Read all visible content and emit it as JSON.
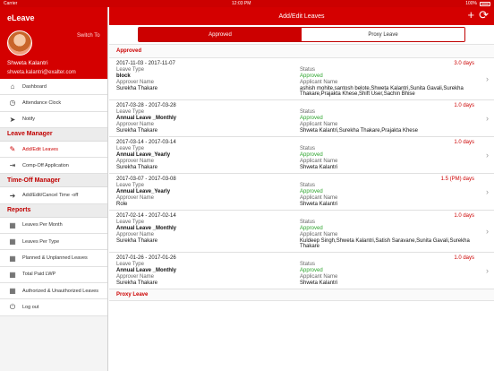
{
  "status_bar": {
    "carrier": "Carrier",
    "time": "12:03 PM",
    "battery": "100%"
  },
  "sidebar": {
    "app_title": "eLeave",
    "switch_to": "Switch To",
    "user_name": "Shweta Kalantri",
    "user_email": "shweta.kalantri@exalter.com",
    "items_top": [
      {
        "label": "Dashboard",
        "icon": "dashboard-icon"
      },
      {
        "label": "Attendance Clock",
        "icon": "clock-icon"
      },
      {
        "label": "Notify",
        "icon": "send-icon"
      }
    ],
    "section_leave": "Leave Manager",
    "items_leave": [
      {
        "label": "Add/Edit Leaves",
        "icon": "edit-icon"
      },
      {
        "label": "Comp-Off Application",
        "icon": "compoff-icon"
      }
    ],
    "section_timeoff": "Time-Off Manager",
    "items_timeoff": [
      {
        "label": "Add/Edit/Cancel Time -off",
        "icon": "arrow-icon"
      }
    ],
    "section_reports": "Reports",
    "items_reports": [
      {
        "label": "Leaves Per Month",
        "icon": "calendar-icon"
      },
      {
        "label": "Leaves Per Type",
        "icon": "calendar-icon"
      },
      {
        "label": "Planned & Unplanned Leaves",
        "icon": "calendar-icon"
      },
      {
        "label": "Total Paid LWP",
        "icon": "calendar-icon"
      },
      {
        "label": "Authorized & Unauthorized Leaves",
        "icon": "calendar-icon"
      },
      {
        "label": "Log out",
        "icon": "power-icon"
      }
    ]
  },
  "main": {
    "title": "Add/Edit Leaves",
    "tabs": {
      "approved": "Approved",
      "proxy": "Proxy Leave"
    },
    "section_approved": "Approved",
    "section_proxy": "Proxy Leave",
    "labels": {
      "leave_type": "Leave Type",
      "status": "Status",
      "approver_name": "Approver Name",
      "applicant_name": "Applicant Name"
    },
    "leaves": [
      {
        "dates": "2017-11-03 - 2017-11-07",
        "days": "3.0 days",
        "leave_type": "block",
        "status": "Approved",
        "approver": "Surekha Thakare",
        "applicant": "ashish mohite,santosh belote,Shweta Kalantri,Sunita Gavali,Surekha Thakare,Prajakta Khese,Shift User,Sachin Bhise"
      },
      {
        "dates": "2017-03-28 - 2017-03-28",
        "days": "1.0 days",
        "leave_type": "Annual Leave _Monthly",
        "status": "Approved",
        "approver": "Surekha Thakare",
        "applicant": "Shweta Kalantri,Surekha Thakare,Prajakta Khese"
      },
      {
        "dates": "2017-03-14 - 2017-03-14",
        "days": "1.0 days",
        "leave_type": "Annual Leave_Yearly",
        "status": "Approved",
        "approver": "Surekha Thakare",
        "applicant": "Shweta Kalantri"
      },
      {
        "dates": "2017-03-07 - 2017-03-08",
        "days": "1.5 (PM) days",
        "leave_type": "Annual Leave_Yearly",
        "status": "Approved",
        "approver": "Role",
        "applicant": "Shweta Kalantri"
      },
      {
        "dates": "2017-02-14 - 2017-02-14",
        "days": "1.0 days",
        "leave_type": "Annual Leave _Monthly",
        "status": "Approved",
        "approver": "Surekha Thakare",
        "applicant": "Kuldeep Singh,Shweta Kalantri,Satish Saravane,Sunita Gavali,Surekha Thakare"
      },
      {
        "dates": "2017-01-26 - 2017-01-26",
        "days": "1.0 days",
        "leave_type": "Annual Leave _Monthly",
        "status": "Approved",
        "approver": "Surekha Thakare",
        "applicant": "Shweta Kalantri"
      }
    ]
  }
}
